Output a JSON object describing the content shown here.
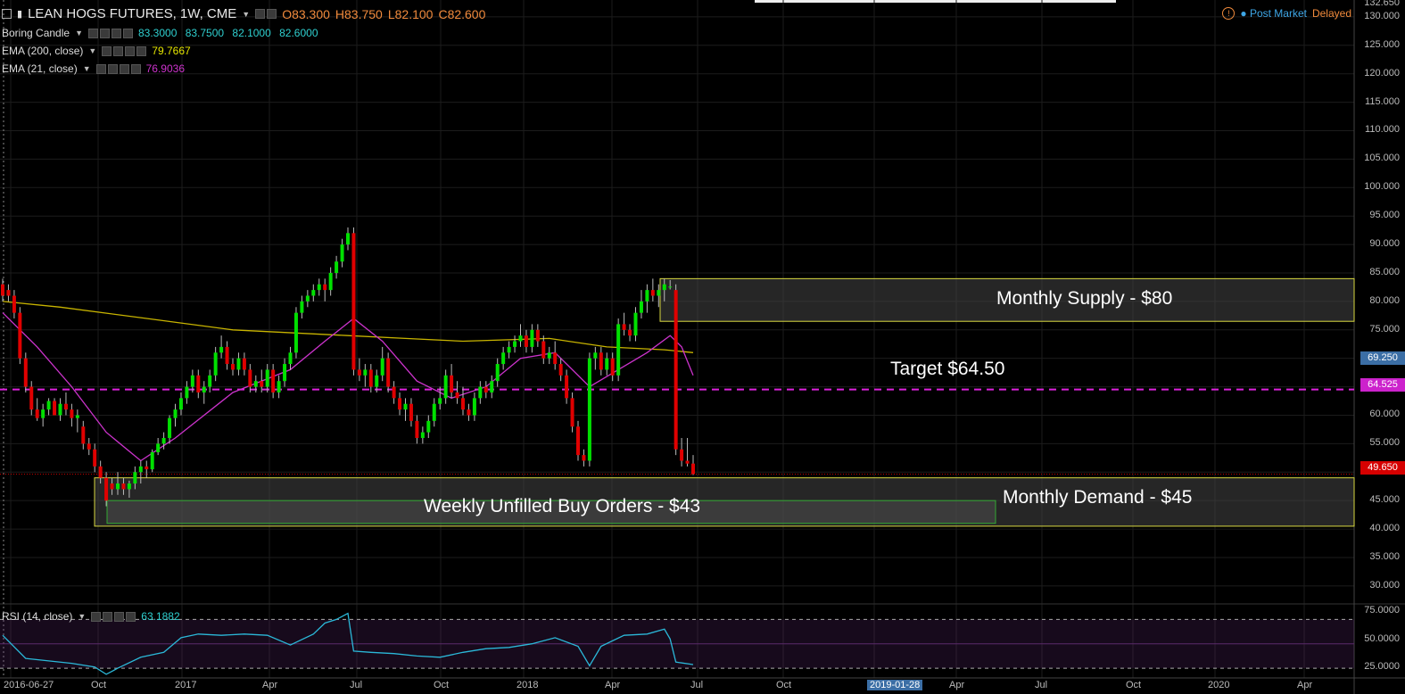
{
  "header": {
    "symbol": "LEAN HOGS FUTURES, 1W, CME",
    "open": "O83.300",
    "high": "H83.750",
    "low": "L82.100",
    "close": "C82.600"
  },
  "indicators": [
    {
      "name": "Boring Candle",
      "values": "83.3000  83.7500  82.1000  82.6000",
      "color": "#2fd0d0"
    },
    {
      "name": "EMA (200, close)",
      "values": "79.7667",
      "color": "#e6e600"
    },
    {
      "name": "EMA (21, close)",
      "values": "76.9036",
      "color": "#cc33cc"
    }
  ],
  "rsi": {
    "name": "RSI (14, close)",
    "value": "63.1882",
    "color": "#2fd0d0"
  },
  "status": {
    "alert_icon": "alert-circle-icon",
    "post_market": "Post Market",
    "delayed": "Delayed"
  },
  "price_axis": {
    "top_value": "132.650",
    "labels": [
      "130.000",
      "125.000",
      "120.000",
      "115.000",
      "110.000",
      "105.000",
      "100.000",
      "95.000",
      "90.000",
      "85.000",
      "80.000",
      "75.000",
      "70.000",
      "65.000",
      "60.000",
      "55.000",
      "50.000",
      "45.000",
      "40.000",
      "35.000",
      "30.000"
    ],
    "tags": [
      {
        "text": "69.250",
        "color": "#3b6ea5"
      },
      {
        "text": "64.525",
        "color": "#cc22cc"
      },
      {
        "text": "49.650",
        "color": "#d60000"
      }
    ]
  },
  "rsi_axis": {
    "labels": [
      "75.0000",
      "50.0000",
      "25.0000"
    ]
  },
  "time_axis": {
    "labels": [
      "2016-06-27",
      "Oct",
      "2017",
      "Apr",
      "Jul",
      "Oct",
      "2018",
      "Apr",
      "Jul",
      "Oct",
      "2019-01-28",
      "Apr",
      "Jul",
      "Oct",
      "2020",
      "Apr"
    ]
  },
  "annotations": {
    "supply": "Monthly Supply - $80",
    "target": "Target $64.50",
    "demand": "Monthly Demand - $45",
    "weekly": "Weekly Unfilled Buy Orders - $43"
  },
  "colors": {
    "up": "#00e000",
    "down": "#e00000",
    "ema200": "#c8b400",
    "ema21": "#cc33cc",
    "rsi_line": "#2bb8d8",
    "target_line": "#dd22dd",
    "zone_border_yellow": "#d8d840",
    "zone_border_green": "#33aa33"
  },
  "chart_data": {
    "type": "candlestick",
    "ylim": [
      27,
      132.65
    ],
    "candles": [
      [
        83.0,
        84.0,
        80.0,
        81.0
      ],
      [
        82.0,
        83.0,
        80.0,
        81.0
      ],
      [
        81.0,
        82.0,
        77.0,
        78.0
      ],
      [
        78.0,
        79.0,
        69.0,
        70.0
      ],
      [
        70.0,
        71.0,
        64.0,
        65.0
      ],
      [
        65.0,
        66.0,
        60.0,
        61.0
      ],
      [
        61.0,
        63.0,
        59.0,
        59.5
      ],
      [
        59.5,
        62.0,
        58.0,
        61.0
      ],
      [
        61.0,
        63.0,
        60.0,
        62.5
      ],
      [
        62.5,
        63.0,
        60.0,
        60.0
      ],
      [
        60.0,
        63.0,
        59.0,
        62.0
      ],
      [
        62.0,
        64.0,
        60.0,
        61.0
      ],
      [
        61.0,
        62.0,
        58.0,
        59.5
      ],
      [
        59.5,
        61.0,
        57.0,
        60.0
      ],
      [
        58.0,
        59.0,
        54.0,
        55.0
      ],
      [
        55.0,
        56.0,
        53.0,
        54.0
      ],
      [
        54.0,
        55.0,
        50.0,
        51.0
      ],
      [
        51.0,
        52.0,
        48.0,
        49.0
      ],
      [
        49.0,
        50.0,
        44.0,
        45.0
      ],
      [
        48.0,
        49.0,
        46.0,
        47.0
      ],
      [
        47.0,
        50.0,
        46.0,
        48.0
      ],
      [
        48.0,
        49.0,
        46.0,
        47.0
      ],
      [
        47.0,
        48.5,
        45.5,
        48.0
      ],
      [
        48.0,
        51.0,
        47.0,
        50.0
      ],
      [
        50.0,
        52.0,
        48.0,
        51.0
      ],
      [
        51.0,
        52.0,
        49.0,
        50.5
      ],
      [
        50.5,
        54.0,
        50.0,
        53.5
      ],
      [
        53.5,
        56.0,
        53.0,
        55.0
      ],
      [
        55.0,
        57.0,
        54.0,
        56.0
      ],
      [
        56.0,
        60.0,
        55.0,
        59.5
      ],
      [
        59.5,
        62.0,
        58.0,
        61.0
      ],
      [
        61.0,
        64.0,
        60.0,
        63.0
      ],
      [
        63.0,
        66.0,
        62.0,
        65.0
      ],
      [
        65.0,
        68.0,
        64.0,
        67.0
      ],
      [
        67.0,
        68.0,
        63.0,
        64.0
      ],
      [
        64.0,
        66.0,
        62.0,
        65.0
      ],
      [
        65.0,
        68.0,
        64.0,
        67.0
      ],
      [
        67.0,
        72.0,
        66.0,
        71.0
      ],
      [
        71.0,
        74.0,
        70.0,
        72.0
      ],
      [
        72.0,
        73.0,
        68.0,
        69.0
      ],
      [
        69.0,
        70.0,
        67.0,
        68.0
      ],
      [
        68.0,
        71.0,
        67.0,
        70.0
      ],
      [
        70.0,
        71.0,
        67.0,
        68.0
      ],
      [
        68.0,
        69.0,
        64.0,
        65.0
      ],
      [
        65.0,
        67.0,
        64.0,
        66.0
      ],
      [
        66.0,
        68.0,
        64.0,
        65.0
      ],
      [
        65.0,
        69.0,
        64.0,
        68.0
      ],
      [
        68.0,
        69.0,
        63.0,
        64.0
      ],
      [
        64.0,
        67.0,
        63.0,
        66.0
      ],
      [
        66.0,
        70.0,
        65.0,
        69.0
      ],
      [
        69.0,
        72.0,
        68.0,
        71.0
      ],
      [
        71.0,
        79.0,
        70.0,
        78.0
      ],
      [
        78.0,
        81.0,
        77.0,
        80.0
      ],
      [
        80.0,
        82.0,
        79.0,
        81.0
      ],
      [
        81.0,
        83.0,
        80.0,
        82.0
      ],
      [
        82.0,
        84.0,
        81.0,
        83.0
      ],
      [
        83.0,
        84.0,
        80.0,
        82.0
      ],
      [
        82.0,
        86.0,
        81.0,
        85.0
      ],
      [
        85.0,
        88.0,
        84.0,
        87.0
      ],
      [
        87.0,
        91.0,
        86.0,
        90.0
      ],
      [
        90.0,
        93.0,
        89.0,
        92.0
      ],
      [
        92.0,
        93.0,
        67.0,
        68.0
      ],
      [
        68.0,
        70.0,
        66.0,
        67.0
      ],
      [
        67.0,
        69.0,
        65.0,
        68.0
      ],
      [
        68.0,
        69.0,
        64.0,
        65.0
      ],
      [
        65.0,
        68.0,
        64.0,
        67.0
      ],
      [
        67.0,
        72.0,
        66.0,
        70.0
      ],
      [
        70.0,
        71.0,
        64.0,
        65.0
      ],
      [
        65.0,
        66.0,
        62.0,
        63.0
      ],
      [
        63.0,
        64.0,
        60.0,
        61.0
      ],
      [
        61.0,
        63.0,
        59.0,
        62.0
      ],
      [
        62.0,
        63.0,
        58.0,
        59.0
      ],
      [
        59.0,
        60.0,
        55.0,
        56.0
      ],
      [
        56.0,
        58.0,
        55.0,
        57.0
      ],
      [
        57.0,
        60.0,
        56.0,
        59.0
      ],
      [
        59.0,
        63.0,
        58.0,
        62.0
      ],
      [
        62.0,
        65.0,
        61.0,
        63.0
      ],
      [
        63.0,
        68.0,
        62.0,
        67.0
      ],
      [
        67.0,
        69.0,
        63.0,
        64.0
      ],
      [
        64.0,
        66.0,
        62.0,
        63.0
      ],
      [
        63.0,
        65.0,
        60.0,
        61.0
      ],
      [
        61.0,
        62.0,
        59.0,
        60.0
      ],
      [
        60.0,
        64.0,
        59.0,
        63.0
      ],
      [
        63.0,
        66.0,
        62.0,
        65.0
      ],
      [
        65.0,
        66.0,
        63.0,
        64.0
      ],
      [
        64.0,
        67.0,
        63.0,
        66.0
      ],
      [
        66.0,
        70.0,
        65.0,
        69.0
      ],
      [
        69.0,
        72.0,
        68.0,
        71.0
      ],
      [
        71.0,
        73.0,
        70.0,
        72.0
      ],
      [
        72.0,
        74.0,
        71.0,
        73.0
      ],
      [
        73.0,
        76.0,
        72.0,
        74.0
      ],
      [
        74.0,
        75.0,
        71.0,
        72.0
      ],
      [
        72.0,
        76.0,
        71.0,
        75.0
      ],
      [
        75.0,
        76.0,
        72.0,
        73.0
      ],
      [
        73.0,
        74.0,
        69.0,
        70.0
      ],
      [
        70.0,
        72.0,
        69.0,
        71.0
      ],
      [
        71.0,
        73.0,
        68.0,
        69.0
      ],
      [
        69.0,
        70.0,
        66.0,
        67.0
      ],
      [
        67.0,
        68.0,
        62.0,
        63.0
      ],
      [
        63.0,
        64.0,
        57.0,
        58.0
      ],
      [
        58.0,
        59.0,
        52.0,
        53.0
      ],
      [
        53.0,
        54.0,
        51.0,
        52.0
      ],
      [
        52.0,
        71.0,
        51.0,
        70.0
      ],
      [
        70.0,
        72.0,
        68.0,
        71.0
      ],
      [
        71.0,
        72.0,
        67.0,
        68.0
      ],
      [
        68.0,
        71.0,
        67.0,
        70.0
      ],
      [
        70.0,
        71.0,
        66.0,
        67.0
      ],
      [
        67.0,
        77.0,
        66.0,
        76.0
      ],
      [
        76.0,
        78.0,
        74.0,
        75.0
      ],
      [
        75.0,
        76.0,
        73.0,
        74.0
      ],
      [
        74.0,
        79.0,
        73.0,
        78.0
      ],
      [
        78.0,
        82.0,
        77.0,
        80.0
      ],
      [
        80.0,
        83.0,
        78.0,
        82.0
      ],
      [
        82.0,
        84.0,
        80.0,
        81.0
      ],
      [
        81.0,
        83.0,
        79.0,
        82.0
      ],
      [
        82.0,
        84.0,
        80.0,
        83.0
      ],
      [
        82.6,
        83.75,
        82.1,
        82.6
      ],
      [
        82.0,
        83.0,
        53.0,
        54.0
      ],
      [
        54.0,
        56.0,
        51.0,
        52.0
      ],
      [
        52.0,
        56.0,
        51.0,
        51.5
      ],
      [
        51.5,
        53.0,
        49.5,
        49.65
      ]
    ],
    "ema200_points": [
      [
        0,
        80.0
      ],
      [
        10,
        79.0
      ],
      [
        25,
        77.0
      ],
      [
        40,
        75.0
      ],
      [
        60,
        74.0
      ],
      [
        70,
        73.5
      ],
      [
        80,
        73.0
      ],
      [
        95,
        73.5
      ],
      [
        105,
        72.0
      ],
      [
        115,
        71.5
      ],
      [
        120,
        71.0
      ]
    ],
    "ema21_points": [
      [
        0,
        78.0
      ],
      [
        6,
        72.0
      ],
      [
        12,
        65.0
      ],
      [
        18,
        57.0
      ],
      [
        24,
        52.0
      ],
      [
        30,
        56.0
      ],
      [
        40,
        64.0
      ],
      [
        50,
        68.0
      ],
      [
        56,
        73.0
      ],
      [
        61,
        77.0
      ],
      [
        66,
        73.0
      ],
      [
        72,
        66.0
      ],
      [
        78,
        63.0
      ],
      [
        84,
        65.0
      ],
      [
        90,
        70.0
      ],
      [
        96,
        71.0
      ],
      [
        102,
        65.0
      ],
      [
        107,
        68.0
      ],
      [
        112,
        71.0
      ],
      [
        116,
        74.0
      ],
      [
        118,
        72.0
      ],
      [
        120,
        67.0
      ]
    ],
    "rsi": {
      "ylim": [
        22,
        82
      ],
      "points": [
        [
          0,
          57
        ],
        [
          4,
          38
        ],
        [
          8,
          36
        ],
        [
          12,
          34
        ],
        [
          16,
          31
        ],
        [
          18,
          25
        ],
        [
          20,
          30
        ],
        [
          24,
          39
        ],
        [
          28,
          43
        ],
        [
          31,
          55
        ],
        [
          34,
          58
        ],
        [
          38,
          57
        ],
        [
          42,
          58
        ],
        [
          46,
          57
        ],
        [
          50,
          49
        ],
        [
          54,
          58
        ],
        [
          56,
          67
        ],
        [
          58,
          70
        ],
        [
          60,
          75
        ],
        [
          61,
          44
        ],
        [
          64,
          43
        ],
        [
          68,
          42
        ],
        [
          72,
          40
        ],
        [
          76,
          39
        ],
        [
          80,
          43
        ],
        [
          84,
          46
        ],
        [
          88,
          47
        ],
        [
          92,
          50
        ],
        [
          96,
          55
        ],
        [
          100,
          48
        ],
        [
          102,
          32
        ],
        [
          104,
          48
        ],
        [
          108,
          57
        ],
        [
          112,
          58
        ],
        [
          115,
          62
        ],
        [
          116,
          54
        ],
        [
          117,
          35
        ],
        [
          120,
          33
        ]
      ],
      "dashed_upper": 70,
      "dashed_lower": 30
    }
  }
}
